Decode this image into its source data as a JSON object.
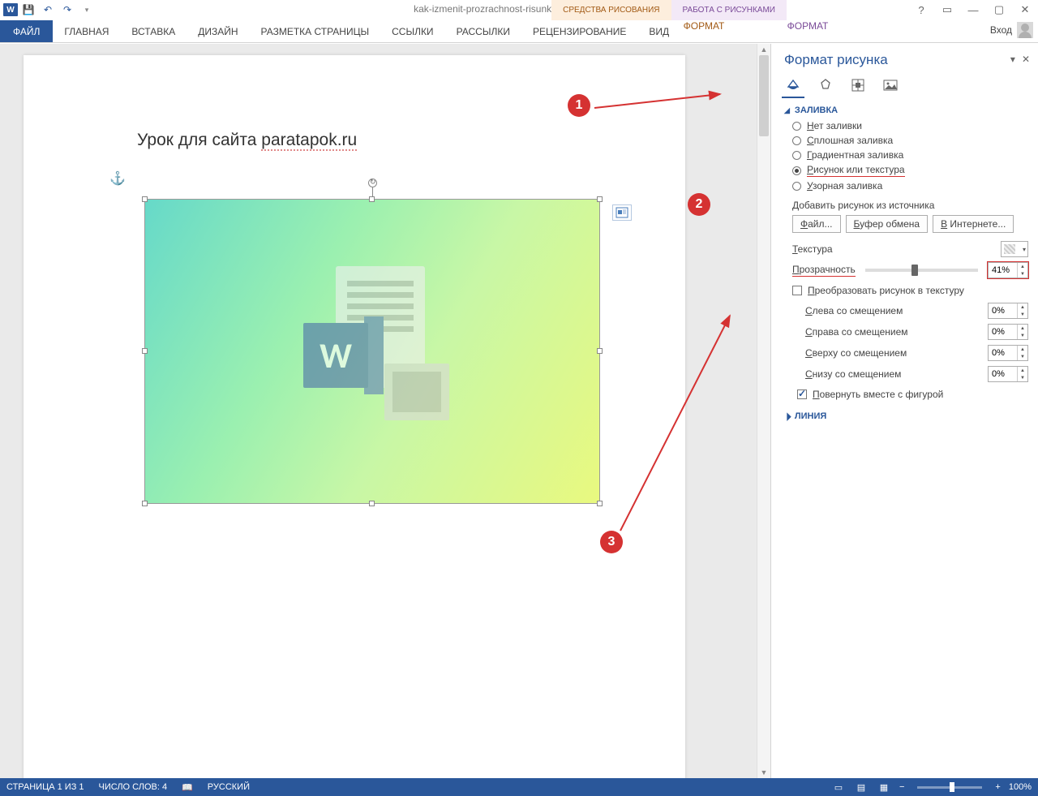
{
  "titlebar": {
    "doc_title": "kak-izmenit-prozrachnost-risunka-v-vorde - Word",
    "ctx_drawing": "СРЕДСТВА РИСОВАНИЯ",
    "ctx_picture": "РАБОТА С РИСУНКАМИ",
    "login": "Вход"
  },
  "ribbon": {
    "file": "ФАЙЛ",
    "tabs": [
      "ГЛАВНАЯ",
      "ВСТАВКА",
      "ДИЗАЙН",
      "РАЗМЕТКА СТРАНИЦЫ",
      "ССЫЛКИ",
      "РАССЫЛКИ",
      "РЕЦЕНЗИРОВАНИЕ",
      "ВИД"
    ],
    "format1": "ФОРМАТ",
    "format2": "ФОРМАТ"
  },
  "page": {
    "text_prefix": "Урок для сайта ",
    "text_link": "paratapok.ru"
  },
  "sidebar": {
    "title": "Формат рисунка",
    "section_fill": "ЗАЛИВКА",
    "section_line": "ЛИНИЯ",
    "radios": {
      "none": "Нет заливки",
      "solid": "Сплошная заливка",
      "gradient": "Градиентная заливка",
      "picture": "Рисунок или текстура",
      "pattern": "Узорная заливка"
    },
    "add_from": "Добавить рисунок из источника",
    "btn_file": "Файл...",
    "btn_clip": "Буфер обмена",
    "btn_online": "В Интернете...",
    "texture": "Текстура",
    "transparency": "Прозрачность",
    "transparency_val": "41%",
    "tile": "Преобразовать рисунок в текстуру",
    "off_left": "Слева со смещением",
    "off_right": "Справа со смещением",
    "off_top": "Сверху со смещением",
    "off_bottom": "Снизу со смещением",
    "offset_val": "0%",
    "rotate": "Повернуть вместе с фигурой"
  },
  "annot": {
    "one": "1",
    "two": "2",
    "three": "3"
  },
  "status": {
    "page": "СТРАНИЦА 1 ИЗ 1",
    "words": "ЧИСЛО СЛОВ: 4",
    "lang": "РУССКИЙ",
    "zoom": "100%"
  }
}
